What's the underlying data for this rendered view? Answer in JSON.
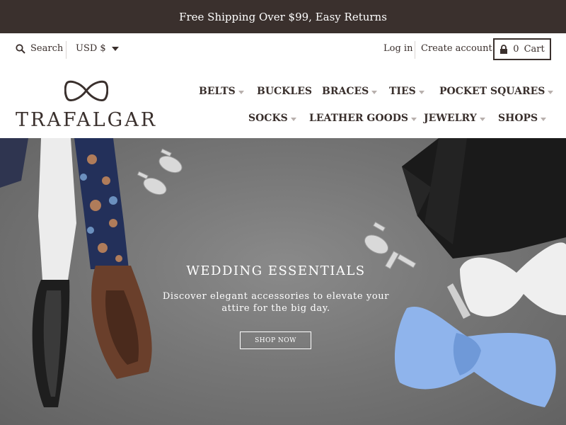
{
  "announcement": {
    "text": "Free Shipping Over $99, Easy Returns"
  },
  "utility": {
    "search_label": "Search",
    "currency_label": "USD $",
    "login_label": "Log in",
    "create_account_label": "Create account",
    "cart_count": "0",
    "cart_label": "Cart"
  },
  "brand": {
    "name": "TRAFALGAR",
    "logo_icon": "bowtie-icon"
  },
  "nav": {
    "items": [
      {
        "label": "BELTS",
        "dropdown": true
      },
      {
        "label": "BUCKLES",
        "dropdown": false
      },
      {
        "label": "BRACES",
        "dropdown": true
      },
      {
        "label": "TIES",
        "dropdown": true
      },
      {
        "label": "POCKET SQUARES",
        "dropdown": true
      },
      {
        "label": "SOCKS",
        "dropdown": true
      },
      {
        "label": "LEATHER GOODS",
        "dropdown": true
      },
      {
        "label": "JEWELRY",
        "dropdown": true
      },
      {
        "label": "SHOPS",
        "dropdown": true
      }
    ]
  },
  "hero": {
    "title": "WEDDING ESSENTIALS",
    "subtitle": "Discover elegant accessories to elevate your attire for the big day.",
    "button_label": "SHOP NOW"
  },
  "colors": {
    "announcement_bg": "#3a302d",
    "text": "#3a2f2c",
    "hero_bg": "#777777",
    "bowtie_blue": "#8fb4ec"
  }
}
